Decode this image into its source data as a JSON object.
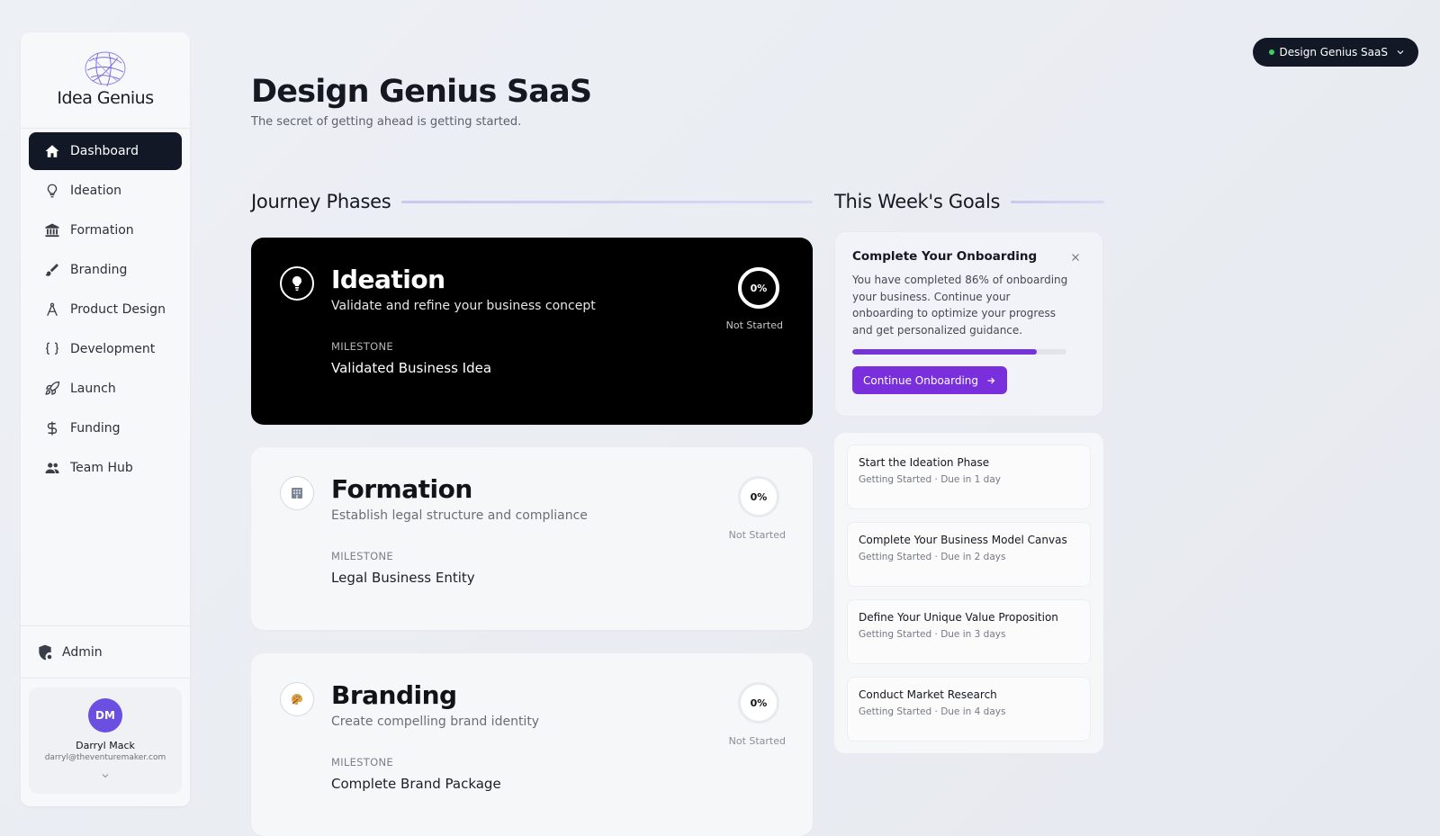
{
  "app": {
    "logo_text": "Idea Genius"
  },
  "sidebar": {
    "items": [
      {
        "label": "Dashboard",
        "icon": "home-icon",
        "active": true
      },
      {
        "label": "Ideation",
        "icon": "lightbulb-icon"
      },
      {
        "label": "Formation",
        "icon": "bank-icon"
      },
      {
        "label": "Branding",
        "icon": "brush-icon"
      },
      {
        "label": "Product Design",
        "icon": "compass-icon"
      },
      {
        "label": "Development",
        "icon": "code-braces-icon"
      },
      {
        "label": "Launch",
        "icon": "rocket-icon"
      },
      {
        "label": "Funding",
        "icon": "dollar-icon"
      },
      {
        "label": "Team Hub",
        "icon": "people-icon"
      }
    ],
    "admin_label": "Admin",
    "user": {
      "initials": "DM",
      "name": "Darryl Mack",
      "email": "darryl@theventuremaker.com"
    }
  },
  "project_select": {
    "label": "Design Genius SaaS"
  },
  "header": {
    "title": "Design Genius SaaS",
    "subtitle": "The secret of getting ahead is getting started."
  },
  "journey": {
    "heading": "Journey Phases",
    "milestone_label": "MILESTONE",
    "phases": [
      {
        "title": "Ideation",
        "desc": "Validate and refine your business concept",
        "milestone": "Validated Business Idea",
        "progress": "0%",
        "status": "Not Started",
        "icon": "lightbulb-icon"
      },
      {
        "title": "Formation",
        "desc": "Establish legal structure and compliance",
        "milestone": "Legal Business Entity",
        "progress": "0%",
        "status": "Not Started",
        "icon": "building-icon"
      },
      {
        "title": "Branding",
        "desc": "Create compelling brand identity",
        "milestone": "Complete Brand Package",
        "progress": "0%",
        "status": "Not Started",
        "icon": "palette-icon"
      }
    ]
  },
  "goals": {
    "heading": "This Week's Goals",
    "onboarding": {
      "title": "Complete Your Onboarding",
      "text": "You have completed 86% of onboarding your business. Continue your onboarding to optimize your progress and get personalized guidance.",
      "progress": 0.86,
      "button": "Continue Onboarding"
    },
    "items": [
      {
        "title": "Start the Ideation Phase",
        "meta": "Getting Started · Due in 1 day"
      },
      {
        "title": "Complete Your Business Model Canvas",
        "meta": "Getting Started · Due in 2 days"
      },
      {
        "title": "Define Your Unique Value Proposition",
        "meta": "Getting Started · Due in 3 days"
      },
      {
        "title": "Conduct Market Research",
        "meta": "Getting Started · Due in 4 days"
      }
    ]
  },
  "colors": {
    "accent": "#7a2fdc",
    "dark": "#121826",
    "status_dot": "#3ecf6b"
  }
}
